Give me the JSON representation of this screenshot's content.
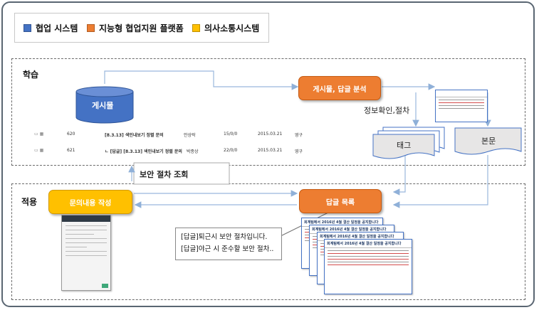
{
  "legend": {
    "items": [
      {
        "label": "협업 시스템",
        "color": "#4472c4"
      },
      {
        "label": "지능형 협업지원 플랫폼",
        "color": "#ed7d31"
      },
      {
        "label": "의사소통시스템",
        "color": "#ffc000"
      }
    ]
  },
  "sections": {
    "learning": "학습",
    "application": "적용"
  },
  "nodes": {
    "posts_db": "게시물",
    "analysis": "게시물, 답글 분석",
    "info_label": "정보확인,절차",
    "tag": "태그",
    "body": "본문",
    "inquiry": "문의내용 작성",
    "reply_list": "답글 목록",
    "security_query": "보안 절차 조회"
  },
  "post_table": {
    "rows": [
      {
        "num": "620",
        "title": "[8.3.13] 색인내보기 정렬 문의",
        "author": "안상락",
        "views": "15/0/0",
        "date": "2015.03.21",
        "dept": "영구"
      },
      {
        "num": "621",
        "title": "ㄴ [답글] [8.3.13] 색인내보기 정렬 문의",
        "author": "박종상",
        "views": "22/0/0",
        "date": "2015.03.21",
        "dept": "영구"
      }
    ]
  },
  "callout": {
    "line1": "[답글]퇴근시 보안 절차입니다.",
    "line2": "[답글]야근 시 준수할 보안 절차.."
  },
  "doc_cards": {
    "title": "회계팀에서 2016년 4월 결산 일정을 공지합니다"
  },
  "colors": {
    "db_blue": "#4472c4",
    "platform_orange": "#ed7d31",
    "comm_yellow": "#ffc000",
    "doc_gray": "#e7e6e6"
  }
}
